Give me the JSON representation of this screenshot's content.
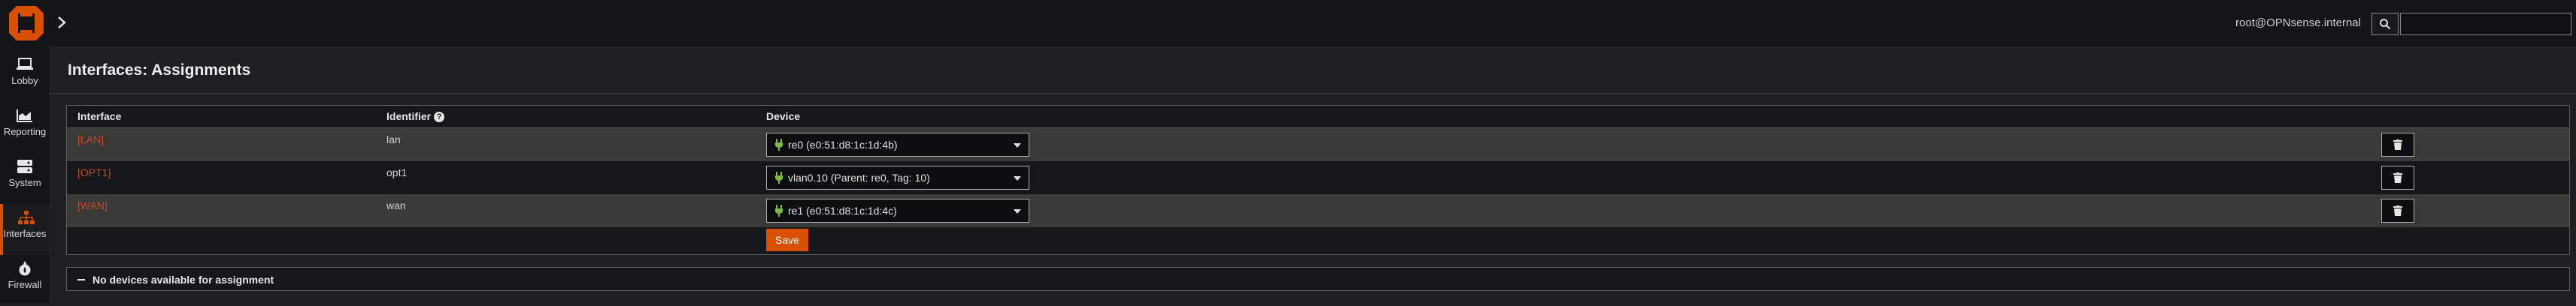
{
  "header": {
    "user": "root@OPNsense.internal",
    "search_placeholder": ""
  },
  "sidebar": {
    "items": [
      {
        "label": "Lobby",
        "icon": "laptop-icon"
      },
      {
        "label": "Reporting",
        "icon": "area-chart-icon"
      },
      {
        "label": "System",
        "icon": "server-icon"
      },
      {
        "label": "Interfaces",
        "icon": "sitemap-icon",
        "active": true
      },
      {
        "label": "Firewall",
        "icon": "fire-icon"
      }
    ]
  },
  "page": {
    "title": "Interfaces: Assignments"
  },
  "table": {
    "columns": {
      "interface": "Interface",
      "identifier": "Identifier",
      "device": "Device"
    },
    "rows": [
      {
        "interface": "[LAN]",
        "identifier": "lan",
        "device": "re0 (e0:51:d8:1c:1d:4b)"
      },
      {
        "interface": "[OPT1]",
        "identifier": "opt1",
        "device": "vlan0.10 (Parent: re0, Tag: 10)"
      },
      {
        "interface": "[WAN]",
        "identifier": "wan",
        "device": "re1 (e0:51:d8:1c:1d:4c)"
      }
    ],
    "save_label": "Save"
  },
  "panel": {
    "label": "No devices available for assignment"
  },
  "colors": {
    "accent": "#d94f00",
    "link": "#c0492b",
    "background": "#1e1f22"
  }
}
